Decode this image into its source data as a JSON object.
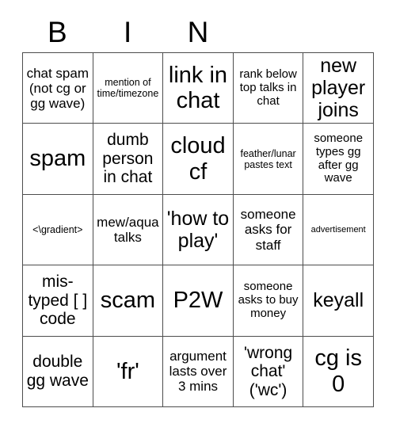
{
  "card": {
    "header_letters": [
      "B",
      "I",
      "N",
      "",
      ""
    ],
    "columns": 5,
    "rows": 5,
    "border_color": "#4d4d4d",
    "background_color": "#ffffff",
    "text_color": "#000000",
    "cells": [
      {
        "text": "chat spam (not cg or gg wave)",
        "size": "fs-md"
      },
      {
        "text": "mention of time/timezone",
        "size": "fs-xs"
      },
      {
        "text": "link in chat",
        "size": "fs-xxl"
      },
      {
        "text": "rank below top talks in chat",
        "size": "fs-sm"
      },
      {
        "text": "new player joins",
        "size": "fs-xl"
      },
      {
        "text": "spam",
        "size": "fs-xxl"
      },
      {
        "text": "dumb person in chat",
        "size": "fs-lg"
      },
      {
        "text": "cloud cf",
        "size": "fs-xxl"
      },
      {
        "text": "feather/lunar pastes text",
        "size": "fs-xs"
      },
      {
        "text": "someone types gg after gg wave",
        "size": "fs-sm"
      },
      {
        "text": "<\\gradient>",
        "size": "fs-xs"
      },
      {
        "text": "mew/aqua talks",
        "size": "fs-md"
      },
      {
        "text": "'how to play'",
        "size": "fs-xl"
      },
      {
        "text": "someone asks for staff",
        "size": "fs-md"
      },
      {
        "text": "advertisement",
        "size": "fs-xxs"
      },
      {
        "text": "mis-typed [ ] code",
        "size": "fs-lg"
      },
      {
        "text": "scam",
        "size": "fs-xxl"
      },
      {
        "text": "P2W",
        "size": "fs-xxl"
      },
      {
        "text": "someone asks to buy money",
        "size": "fs-sm"
      },
      {
        "text": "keyall",
        "size": "fs-xl"
      },
      {
        "text": "double gg wave",
        "size": "fs-lg"
      },
      {
        "text": "'fr'",
        "size": "fs-xxl"
      },
      {
        "text": "argument lasts over 3 mins",
        "size": "fs-md"
      },
      {
        "text": "'wrong chat' ('wc')",
        "size": "fs-lg"
      },
      {
        "text": "cg is 0",
        "size": "fs-xxl"
      }
    ]
  }
}
